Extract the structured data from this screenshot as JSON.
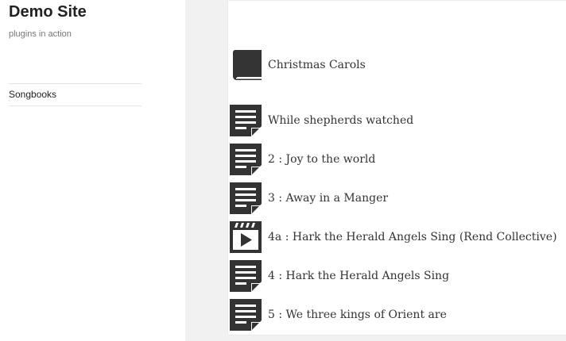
{
  "site": {
    "title": "Demo Site",
    "description": "plugins in action"
  },
  "sidebar": {
    "items": [
      {
        "label": "Songbooks"
      }
    ]
  },
  "content": {
    "book": {
      "title": "Christmas Carols",
      "icon": "book-icon"
    },
    "songs": [
      {
        "label": "While shepherds watched",
        "icon": "document-icon"
      },
      {
        "label": "2 : Joy to the world",
        "icon": "document-icon"
      },
      {
        "label": "3 : Away in a Manger",
        "icon": "document-icon"
      },
      {
        "label": "4a : Hark the Herald Angels Sing (Rend Collective)",
        "icon": "video-icon"
      },
      {
        "label": "4 : Hark the Herald Angels Sing",
        "icon": "document-icon"
      },
      {
        "label": "5 : We three kings of Orient are",
        "icon": "document-icon"
      }
    ]
  },
  "colors": {
    "icon": "#333333",
    "sidebar_bg": "#ffffff",
    "main_bg": "#f1f1f1"
  }
}
